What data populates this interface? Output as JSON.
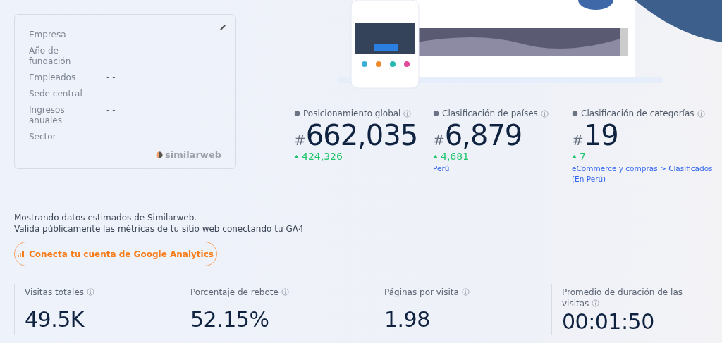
{
  "company_card": {
    "fields": [
      {
        "label": "Empresa",
        "value": "- -"
      },
      {
        "label": "Año de fundación",
        "value": "- -"
      },
      {
        "label": "Empleados",
        "value": "- -"
      },
      {
        "label": "Sede central",
        "value": "- -"
      },
      {
        "label": "Ingresos anuales",
        "value": "- -"
      },
      {
        "label": "Sector",
        "value": "- -"
      }
    ],
    "brand": "similarweb"
  },
  "rankings": [
    {
      "title": "Posicionamiento global",
      "hash": "#",
      "value": "662,035",
      "change": "424,326"
    },
    {
      "title": "Clasificación de países",
      "hash": "#",
      "value": "6,879",
      "change": "4,681",
      "link": "Perú"
    },
    {
      "title": "Clasificación de categorías",
      "hash": "#",
      "value": "19",
      "change": "7",
      "link": "eCommerce y compras > Clasificados (En Perú)"
    }
  ],
  "notice": [
    "Mostrando datos estimados de Similarweb.",
    "Valida públicamente las métricas de tu sitio web conectando tu GA4"
  ],
  "connect_button": "Conecta tu cuenta de Google Analytics",
  "metrics": [
    {
      "label": "Visitas totales",
      "value": "49.5K"
    },
    {
      "label": "Porcentaje de rebote",
      "value": "52.15%"
    },
    {
      "label": "Páginas por visita",
      "value": "1.98"
    },
    {
      "label": "Promedio de duración de las visitas",
      "value": "00:01:50"
    }
  ]
}
